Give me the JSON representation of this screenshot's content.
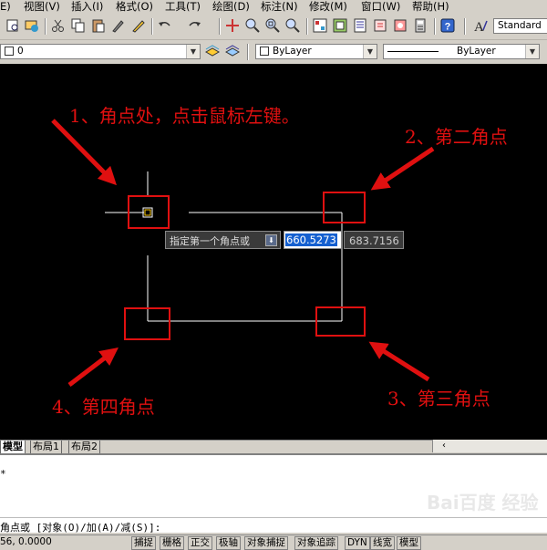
{
  "menubar": {
    "items": [
      "E)",
      "视图(V)",
      "插入(I)",
      "格式(O)",
      "工具(T)",
      "绘图(D)",
      "标注(N)",
      "修改(M)",
      "窗口(W)",
      "帮助(H)"
    ]
  },
  "toolbar": {
    "text_style": "Standard"
  },
  "properties": {
    "layer": "0",
    "color": "ByLayer",
    "linetype": "ByLayer"
  },
  "annotations": {
    "step1": "1、角点处，点击鼠标左键。",
    "step2": "2、第二角点",
    "step3": "3、第三角点",
    "step4": "4、第四角点",
    "box_color": "#e01010",
    "arrow_color": "#e01010"
  },
  "dynamic_input": {
    "prompt": "指定第一个角点或",
    "x_value": "660.5273",
    "y_value": "683.7156"
  },
  "tabs": [
    "模型",
    "布局1",
    "布局2"
  ],
  "command": {
    "line1": "*",
    "prompt": "角点或 [对象(O)/加(A)/减(S)]:"
  },
  "status": {
    "coords": "56, 0.0000",
    "buttons": [
      "捕捉",
      "栅格",
      "正交",
      "极轴",
      "对象捕捉",
      "对象追踪",
      "DYN",
      "线宽",
      "模型"
    ]
  },
  "watermark": "Bai百度 经验"
}
